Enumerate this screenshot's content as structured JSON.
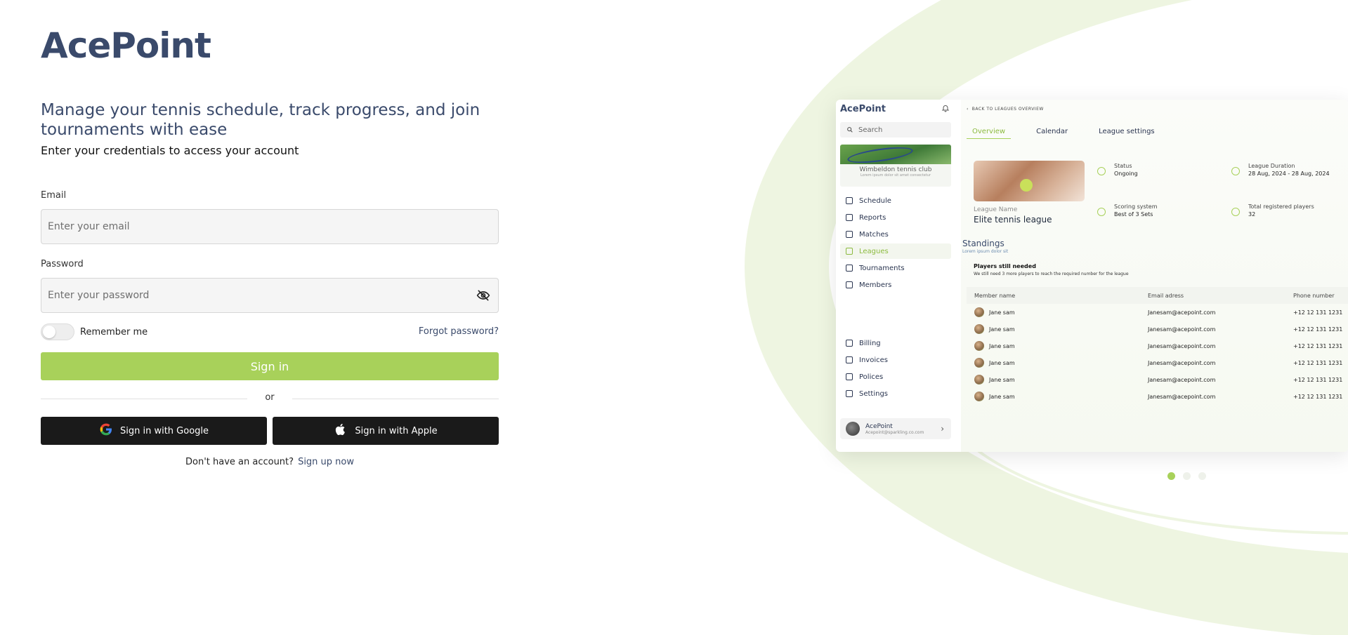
{
  "brand": {
    "logo": "AcePoint"
  },
  "login": {
    "headline": "Manage your tennis schedule, track progress, and join tournaments with ease",
    "subline": "Enter your credentials to access your account",
    "email_label": "Email",
    "email_placeholder": "Enter your email",
    "password_label": "Password",
    "password_placeholder": "Enter your password",
    "remember_label": "Remember me",
    "remember_enabled": false,
    "forgot_label": "Forgot password?",
    "signin_label": "Sign in",
    "or_label": "or",
    "google_label": "Sign in with Google",
    "apple_label": "Sign in with Apple",
    "no_account_text": "Don't have an account?",
    "signup_label": "Sign up now"
  },
  "preview": {
    "logo": "AcePoint",
    "search_placeholder": "Search",
    "club_name": "Wimbeldon tennis club",
    "club_sub": "Lorem ipsum dolor sit amet consectetur",
    "nav_main": [
      "Schedule",
      "Reports",
      "Matches",
      "Leagues",
      "Tournaments",
      "Members"
    ],
    "nav_active": "Leagues",
    "nav_bottom": [
      "Billing",
      "Invoices",
      "Polices",
      "Settings"
    ],
    "user_name": "AcePoint",
    "user_email": "Acepoint@sparkling.co.com",
    "back_link": "BACK TO LEAGUES OVERVIEW",
    "tabs": [
      "Overview",
      "Calendar",
      "League settings"
    ],
    "active_tab": "Overview",
    "league_name_label": "League Name",
    "league_name": "Elite tennis league",
    "stats": {
      "status_label": "Status",
      "status_value": "Ongoing",
      "duration_label": "League Duration",
      "duration_value": "28 Aug, 2024 - 28 Aug, 2024",
      "scoring_label": "Scoring system",
      "scoring_value": "Best of 3 Sets",
      "players_label": "Total registered players",
      "players_value": "32"
    },
    "standings_title": "Standings",
    "standings_sub": "Lorem ipsum dolor sit",
    "needed_title": "Players still needed",
    "needed_sub": "We still need 3 more players to reach the required number for the league",
    "table_headers": [
      "Member name",
      "Email adress",
      "Phone number"
    ],
    "rows": [
      {
        "name": "Jane sam",
        "email": "Janesam@acepoint.com",
        "phone": "+12 12 131 1231"
      },
      {
        "name": "Jane sam",
        "email": "Janesam@acepoint.com",
        "phone": "+12 12 131 1231"
      },
      {
        "name": "Jane sam",
        "email": "Janesam@acepoint.com",
        "phone": "+12 12 131 1231"
      },
      {
        "name": "Jane sam",
        "email": "Janesam@acepoint.com",
        "phone": "+12 12 131 1231"
      },
      {
        "name": "Jane sam",
        "email": "Janesam@acepoint.com",
        "phone": "+12 12 131 1231"
      },
      {
        "name": "Jane sam",
        "email": "Janesam@acepoint.com",
        "phone": "+12 12 131 1231"
      }
    ]
  },
  "carousel": {
    "count": 3,
    "active_index": 0
  },
  "colors": {
    "accent": "#a8d15a",
    "brand_text": "#3a4a6b",
    "dark_button": "#1a1a1a",
    "arc": "#eef5e1"
  }
}
